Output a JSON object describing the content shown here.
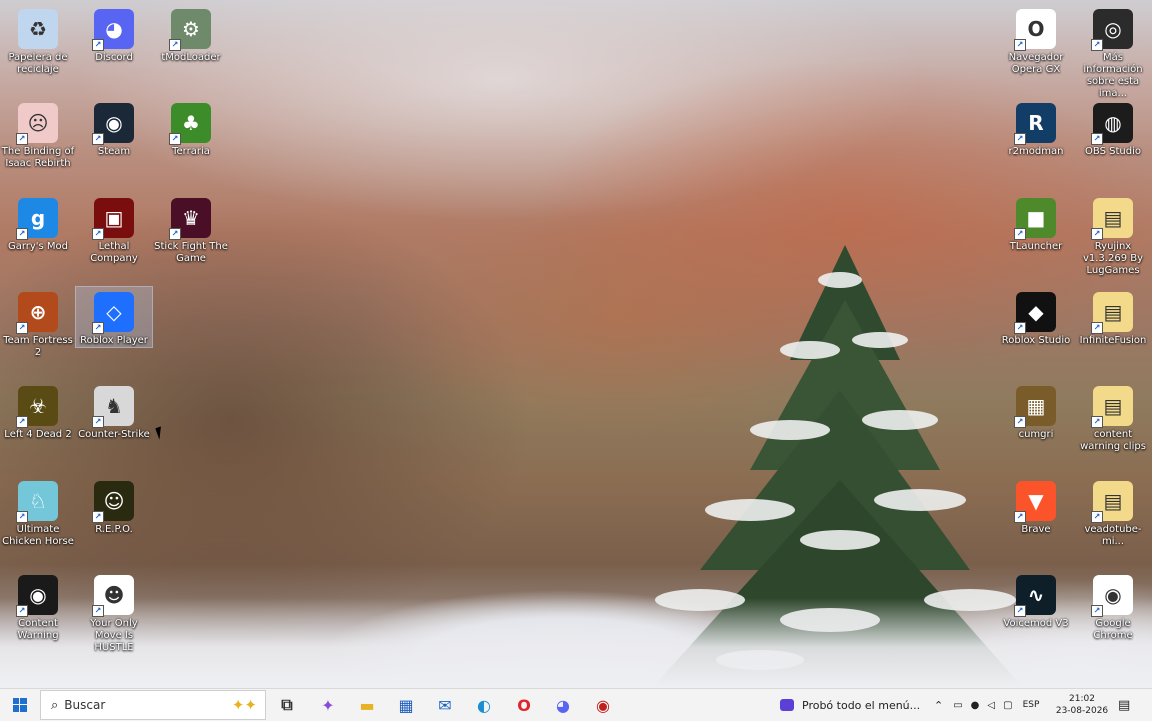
{
  "desktop": {
    "icons": [
      {
        "label": "Papelera de reciclaje",
        "icon": "recycle-bin-icon",
        "bg": "#bfd6ee",
        "glyph": "♻"
      },
      {
        "label": "Discord",
        "icon": "discord-icon",
        "bg": "#5865f2",
        "glyph": "◕"
      },
      {
        "label": "tModLoader",
        "icon": "tmodloader-icon",
        "bg": "#6f8a6a",
        "glyph": "⚙"
      },
      {
        "label": "The Binding of Isaac Rebirth",
        "icon": "isaac-icon",
        "bg": "#f0c9c9",
        "glyph": "☹"
      },
      {
        "label": "Steam",
        "icon": "steam-icon",
        "bg": "#1b2838",
        "glyph": "◉"
      },
      {
        "label": "Terraria",
        "icon": "terraria-icon",
        "bg": "#3d8c2a",
        "glyph": "♣"
      },
      {
        "label": "Garry's Mod",
        "icon": "garrys-mod-icon",
        "bg": "#1e88e5",
        "glyph": "g"
      },
      {
        "label": "Lethal Company",
        "icon": "lethal-company-icon",
        "bg": "#7a0d0d",
        "glyph": "▣"
      },
      {
        "label": "Stick Fight The Game",
        "icon": "stick-fight-icon",
        "bg": "#4a0f26",
        "glyph": "♛"
      },
      {
        "label": "Team Fortress 2",
        "icon": "tf2-icon",
        "bg": "#b24a1b",
        "glyph": "⊕"
      },
      {
        "label": "Roblox Player",
        "icon": "roblox-player-icon",
        "bg": "#1f6fff",
        "glyph": "◇"
      },
      {
        "label": "Left 4 Dead 2",
        "icon": "l4d2-icon",
        "bg": "#5a4a14",
        "glyph": "☣"
      },
      {
        "label": "Counter-Strike",
        "icon": "counter-strike-icon",
        "bg": "#d8d8d8",
        "glyph": "♞"
      },
      {
        "label": "Ultimate Chicken Horse",
        "icon": "chicken-horse-icon",
        "bg": "#74c7d9",
        "glyph": "♘"
      },
      {
        "label": "R.E.P.O.",
        "icon": "repo-icon",
        "bg": "#2a2a10",
        "glyph": "☺"
      },
      {
        "label": "Content Warning",
        "icon": "content-warning-icon",
        "bg": "#1a1a1a",
        "glyph": "◉"
      },
      {
        "label": "Your Only Move Is HUSTLE",
        "icon": "hustle-icon",
        "bg": "#ffffff",
        "glyph": "☻"
      },
      {
        "label": "Navegador Opera GX",
        "icon": "opera-gx-icon",
        "bg": "#ffffff",
        "glyph": "O"
      },
      {
        "label": "Más información sobre esta ima...",
        "icon": "info-camera-icon",
        "bg": "#2b2b2b",
        "glyph": "◎"
      },
      {
        "label": "r2modman",
        "icon": "r2modman-icon",
        "bg": "#123d66",
        "glyph": "R"
      },
      {
        "label": "OBS Studio",
        "icon": "obs-icon",
        "bg": "#1c1c1c",
        "glyph": "◍"
      },
      {
        "label": "TLauncher",
        "icon": "tlauncher-icon",
        "bg": "#4e8a2b",
        "glyph": "■"
      },
      {
        "label": "Ryujinx v1.3.269 By LugGames",
        "icon": "folder-icon",
        "bg": "#f3d98a",
        "glyph": "▤"
      },
      {
        "label": "Roblox Studio",
        "icon": "roblox-studio-icon",
        "bg": "#111111",
        "glyph": "◆"
      },
      {
        "label": "InfiniteFusion",
        "icon": "folder-icon",
        "bg": "#f3d98a",
        "glyph": "▤"
      },
      {
        "label": "cumgri",
        "icon": "image-icon",
        "bg": "#7a5c2a",
        "glyph": "▦"
      },
      {
        "label": "content warning clips",
        "icon": "folder-icon",
        "bg": "#f3d98a",
        "glyph": "▤"
      },
      {
        "label": "Brave",
        "icon": "brave-icon",
        "bg": "#fb542b",
        "glyph": "▼"
      },
      {
        "label": "veadotube-mi...",
        "icon": "folder-icon",
        "bg": "#f3d98a",
        "glyph": "▤"
      },
      {
        "label": "Voicemod V3",
        "icon": "voicemod-icon",
        "bg": "#0e1f2a",
        "glyph": "∿"
      },
      {
        "label": "Google Chrome",
        "icon": "chrome-icon",
        "bg": "#ffffff",
        "glyph": "◉"
      }
    ]
  },
  "taskbar": {
    "search_placeholder": "Buscar",
    "notification_text": "Probó todo el menú...",
    "language": "ESP",
    "time": "21:02",
    "date": "23-08-2026",
    "pinned": [
      {
        "name": "task-view-icon",
        "glyph": "⧉",
        "color": "#333333"
      },
      {
        "name": "copilot-icon",
        "glyph": "✦",
        "color": "#8a4bd6"
      },
      {
        "name": "file-explorer-icon",
        "glyph": "▬",
        "color": "#e6b325"
      },
      {
        "name": "microsoft-store-icon",
        "glyph": "▦",
        "color": "#1f5fbf"
      },
      {
        "name": "outlook-icon",
        "glyph": "✉",
        "color": "#1565c0"
      },
      {
        "name": "edge-icon",
        "glyph": "◐",
        "color": "#1b8ed1"
      },
      {
        "name": "opera-icon",
        "glyph": "O",
        "color": "#e1232e"
      },
      {
        "name": "discord-taskbar-icon",
        "glyph": "◕",
        "color": "#5865f2"
      },
      {
        "name": "app-taskbar-icon",
        "glyph": "◉",
        "color": "#c0201e"
      }
    ]
  }
}
